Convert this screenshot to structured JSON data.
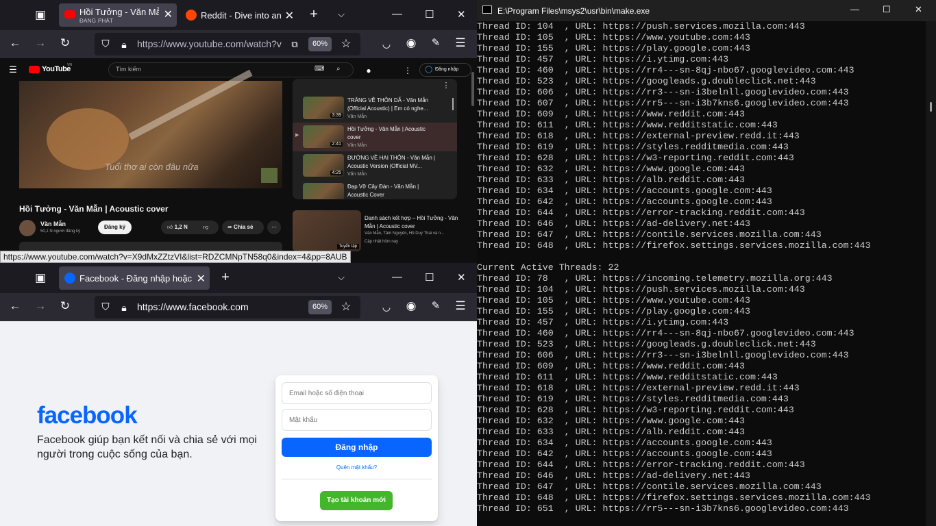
{
  "yt_browser": {
    "tabs": [
      {
        "title": "Hồi Tưởng - Văn Mẫn |",
        "subtitle": "ĐANG PHÁT",
        "active": true
      },
      {
        "title": "Reddit - Dive into anyt",
        "subtitle": "",
        "active": false
      }
    ],
    "url": "https://www.youtube.com/watch?v",
    "zoom": "60%",
    "status_url": "https://www.youtube.com/watch?v=X9dMxZZtzVI&list=RDZCMNpTN58q0&index=4&pp=8AUB",
    "youtube": {
      "logo": "YouTube",
      "region": "VN",
      "search_placeholder": "Tìm kiếm",
      "signin": "Đăng nhập",
      "video_caption": "Tuổi thơ ai còn đâu nữa",
      "video_title": "Hồi Tưởng - Văn Mẫn | Acoustic cover",
      "channel": "Văn Mẫn",
      "subscribers": "50,1 N người đăng ký",
      "subscribe": "Đăng ký",
      "likes": "1,2 N",
      "share": "Chia sẻ",
      "playlist": [
        {
          "title": "TRĂNG VỀ THÔN DÃ - Văn Mẫn (Official Acoustic) | Em có nghe...",
          "channel": "Văn Mẫn",
          "duration": "3:39"
        },
        {
          "title": "Hồi Tưởng - Văn Mẫn | Acoustic cover",
          "channel": "Văn Mẫn",
          "duration": "2:41"
        },
        {
          "title": "ĐƯỜNG VỀ HAI THÔN - Văn Mẫn | Acoustic Version (Official MV...",
          "channel": "Văn Mẫn",
          "duration": "4:25"
        },
        {
          "title": "Đạp Vỡ Cây Đàn - Văn Mẫn | Acoustic Cover",
          "channel": "",
          "duration": ""
        }
      ],
      "mix": {
        "title": "Danh sách kết hợp – Hồi Tưởng - Văn Mẫn | Acoustic cover",
        "artists": "Văn Mẫn, Tâm Nguyên, Hồ Duy Thái và n...",
        "updated": "Cập nhật hôm nay",
        "badge": "Tuyển tập"
      }
    }
  },
  "fb_browser": {
    "tab_title": "Facebook - Đăng nhập hoặc đă",
    "url": "https://www.facebook.com",
    "zoom": "60%",
    "facebook": {
      "logo": "facebook",
      "tagline": "Facebook giúp bạn kết nối và chia sẻ với mọi người trong cuộc sống của bạn.",
      "email_placeholder": "Email hoặc số điện thoại",
      "password_placeholder": "Mật khẩu",
      "login": "Đăng nhập",
      "forgot": "Quên mật khẩu?",
      "create": "Tạo tài khoản mới"
    }
  },
  "console": {
    "title": "E:\\Program Files\\msys2\\usr\\bin\\make.exe",
    "lines": [
      "Thread ID: 104  , URL: https://push.services.mozilla.com:443",
      "Thread ID: 105  , URL: https://www.youtube.com:443",
      "Thread ID: 155  , URL: https://play.google.com:443",
      "Thread ID: 457  , URL: https://i.ytimg.com:443",
      "Thread ID: 460  , URL: https://rr4---sn-8qj-nbo67.googlevideo.com:443",
      "Thread ID: 523  , URL: https://googleads.g.doubleclick.net:443",
      "Thread ID: 606  , URL: https://rr3---sn-i3belnll.googlevideo.com:443",
      "Thread ID: 607  , URL: https://rr5---sn-i3b7kns6.googlevideo.com:443",
      "Thread ID: 609  , URL: https://www.reddit.com:443",
      "Thread ID: 611  , URL: https://www.redditstatic.com:443",
      "Thread ID: 618  , URL: https://external-preview.redd.it:443",
      "Thread ID: 619  , URL: https://styles.redditmedia.com:443",
      "Thread ID: 628  , URL: https://w3-reporting.reddit.com:443",
      "Thread ID: 632  , URL: https://www.google.com:443",
      "Thread ID: 633  , URL: https://alb.reddit.com:443",
      "Thread ID: 634  , URL: https://accounts.google.com:443",
      "Thread ID: 642  , URL: https://accounts.google.com:443",
      "Thread ID: 644  , URL: https://error-tracking.reddit.com:443",
      "Thread ID: 646  , URL: https://ad-delivery.net:443",
      "Thread ID: 647  , URL: https://contile.services.mozilla.com:443",
      "Thread ID: 648  , URL: https://firefox.settings.services.mozilla.com:443",
      "",
      "Current Active Threads: 22",
      "Thread ID: 78   , URL: https://incoming.telemetry.mozilla.org:443",
      "Thread ID: 104  , URL: https://push.services.mozilla.com:443",
      "Thread ID: 105  , URL: https://www.youtube.com:443",
      "Thread ID: 155  , URL: https://play.google.com:443",
      "Thread ID: 457  , URL: https://i.ytimg.com:443",
      "Thread ID: 460  , URL: https://rr4---sn-8qj-nbo67.googlevideo.com:443",
      "Thread ID: 523  , URL: https://googleads.g.doubleclick.net:443",
      "Thread ID: 606  , URL: https://rr3---sn-i3belnll.googlevideo.com:443",
      "Thread ID: 609  , URL: https://www.reddit.com:443",
      "Thread ID: 611  , URL: https://www.redditstatic.com:443",
      "Thread ID: 618  , URL: https://external-preview.redd.it:443",
      "Thread ID: 619  , URL: https://styles.redditmedia.com:443",
      "Thread ID: 628  , URL: https://w3-reporting.reddit.com:443",
      "Thread ID: 632  , URL: https://www.google.com:443",
      "Thread ID: 633  , URL: https://alb.reddit.com:443",
      "Thread ID: 634  , URL: https://accounts.google.com:443",
      "Thread ID: 642  , URL: https://accounts.google.com:443",
      "Thread ID: 644  , URL: https://error-tracking.reddit.com:443",
      "Thread ID: 646  , URL: https://ad-delivery.net:443",
      "Thread ID: 647  , URL: https://contile.services.mozilla.com:443",
      "Thread ID: 648  , URL: https://firefox.settings.services.mozilla.com:443",
      "Thread ID: 651  , URL: https://rr5---sn-i3b7kns6.googlevideo.com:443"
    ]
  },
  "colors": {
    "youtube_red": "#ff0000",
    "facebook_blue": "#0866ff",
    "fb_green": "#42b72a",
    "reddit_orange": "#ff4500"
  }
}
